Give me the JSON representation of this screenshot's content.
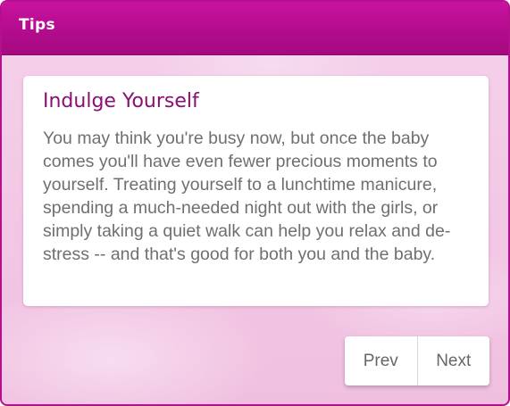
{
  "header": {
    "title": "Tips"
  },
  "tip": {
    "title": "Indulge Yourself",
    "body": "You may think you're busy now, but once the baby comes you'll have even fewer precious moments to yourself. Treating yourself to a lunchtime manicure, spending a much-needed night out with the girls, or simply taking a quiet walk can help you relax and de-stress -- and that's good for both you and the baby."
  },
  "pager": {
    "prev_label": "Prev",
    "next_label": "Next"
  },
  "colors": {
    "header_accent": "#b50c8f",
    "title_text": "#8a0f74",
    "background_tint": "#f3c9e6"
  }
}
